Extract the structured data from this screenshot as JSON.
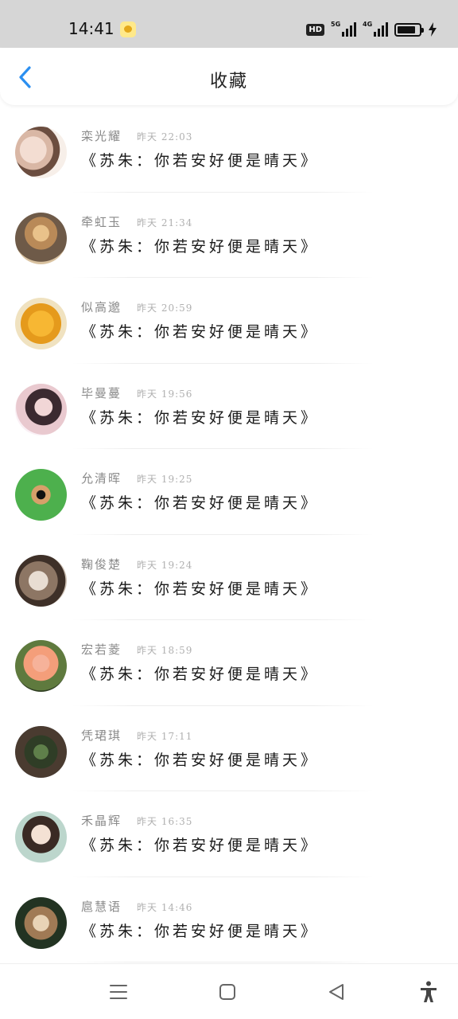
{
  "status_bar": {
    "time": "14:41",
    "app_icon": "qq-notification-icon",
    "hd_label": "HD",
    "network_1": "5G",
    "network_2": "4G",
    "battery_level": 0.85,
    "icons": [
      "hd-icon",
      "signal-5g-icon",
      "signal-4g-icon",
      "battery-icon",
      "charging-icon"
    ]
  },
  "header": {
    "back_icon": "chevron-left-icon",
    "title": "收藏",
    "accent_color": "#2b8ff0"
  },
  "favorites": [
    {
      "name": "栾光耀",
      "time": "昨天 22:03",
      "content": "《苏朱：你若安好便是晴天》"
    },
    {
      "name": "牵虹玉",
      "time": "昨天 21:34",
      "content": "《苏朱：你若安好便是晴天》"
    },
    {
      "name": "似高邈",
      "time": "昨天 20:59",
      "content": "《苏朱：你若安好便是晴天》"
    },
    {
      "name": "毕曼蔓",
      "time": "昨天 19:56",
      "content": "《苏朱：你若安好便是晴天》"
    },
    {
      "name": "允清晖",
      "time": "昨天 19:25",
      "content": "《苏朱：你若安好便是晴天》"
    },
    {
      "name": "鞠俊楚",
      "time": "昨天 19:24",
      "content": "《苏朱：你若安好便是晴天》"
    },
    {
      "name": "宏若菱",
      "time": "昨天 18:59",
      "content": "《苏朱：你若安好便是晴天》"
    },
    {
      "name": "凭珺琪",
      "time": "昨天 17:11",
      "content": "《苏朱：你若安好便是晴天》"
    },
    {
      "name": "禾晶辉",
      "time": "昨天 16:35",
      "content": "《苏朱：你若安好便是晴天》"
    },
    {
      "name": "扈慧语",
      "time": "昨天 14:46",
      "content": "《苏朱：你若安好便是晴天》"
    }
  ],
  "nav_bar": {
    "icons": [
      "menu-icon",
      "home-square-icon",
      "back-triangle-icon",
      "accessibility-icon"
    ]
  }
}
